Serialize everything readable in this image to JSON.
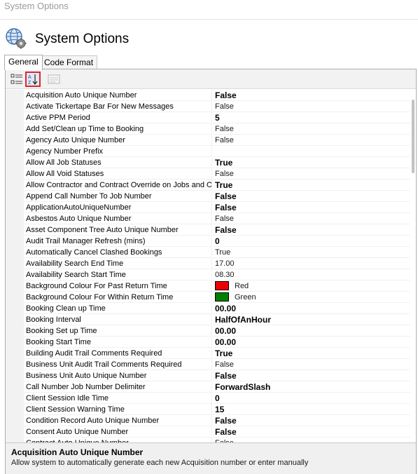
{
  "window": {
    "title": "System Options"
  },
  "header": {
    "title": "System Options",
    "icon": "globe-gear-icon"
  },
  "tabs": [
    {
      "label": "General",
      "active": true
    },
    {
      "label": "Code Format",
      "active": false
    }
  ],
  "toolbar": {
    "buttons": [
      {
        "icon": "categorized-view-icon"
      },
      {
        "icon": "alphabetical-sort-icon",
        "active": true
      },
      {
        "icon": "property-pages-icon",
        "disabled": true
      }
    ]
  },
  "properties": [
    {
      "name": "Acquisition Auto Unique Number",
      "value": "False",
      "bold": true
    },
    {
      "name": "Activate Tickertape Bar For New Messages",
      "value": "False",
      "bold": false
    },
    {
      "name": "Active PPM Period",
      "value": "5",
      "bold": true
    },
    {
      "name": "Add Set/Clean up Time to Booking",
      "value": "False",
      "bold": false
    },
    {
      "name": "Agency Auto Unique Number",
      "value": "False",
      "bold": false
    },
    {
      "name": "Agency Number Prefix",
      "value": "",
      "bold": false
    },
    {
      "name": "Allow All Job Statuses",
      "value": "True",
      "bold": true
    },
    {
      "name": "Allow All Void Statuses",
      "value": "False",
      "bold": false
    },
    {
      "name": "Allow Contractor and Contract Override on Jobs and Ord",
      "value": "True",
      "bold": true
    },
    {
      "name": "Append Call Number To Job Number",
      "value": "False",
      "bold": true
    },
    {
      "name": "ApplicationAutoUniqueNumber",
      "value": "False",
      "bold": true
    },
    {
      "name": "Asbestos Auto Unique Number",
      "value": "False",
      "bold": false
    },
    {
      "name": "Asset Component Tree Auto Unique Number",
      "value": "False",
      "bold": true
    },
    {
      "name": "Audit Trail Manager Refresh (mins)",
      "value": "0",
      "bold": true
    },
    {
      "name": "Automatically Cancel Clashed Bookings",
      "value": "True",
      "bold": false
    },
    {
      "name": "Availability Search End Time",
      "value": "17.00",
      "bold": false
    },
    {
      "name": "Availability Search Start Time",
      "value": "08.30",
      "bold": false
    },
    {
      "name": "Background Colour For Past Return Time",
      "value": "Red",
      "bold": false,
      "swatch": "#ee0000"
    },
    {
      "name": "Background Colour For Within Return Time",
      "value": "Green",
      "bold": false,
      "swatch": "#008000"
    },
    {
      "name": "Booking Clean up Time",
      "value": "00.00",
      "bold": true
    },
    {
      "name": "Booking Interval",
      "value": "HalfOfAnHour",
      "bold": true
    },
    {
      "name": "Booking Set up Time",
      "value": "00.00",
      "bold": true
    },
    {
      "name": "Booking Start Time",
      "value": "00.00",
      "bold": true
    },
    {
      "name": "Building Audit Trail Comments Required",
      "value": "True",
      "bold": true
    },
    {
      "name": "Business Unit Audit Trail Comments Required",
      "value": "False",
      "bold": false
    },
    {
      "name": "Business Unit Auto Unique Number",
      "value": "False",
      "bold": true
    },
    {
      "name": "Call Number Job Number Delimiter",
      "value": "ForwardSlash",
      "bold": true
    },
    {
      "name": "Client Session Idle Time",
      "value": "0",
      "bold": true
    },
    {
      "name": "Client Session Warning Time",
      "value": "15",
      "bold": true
    },
    {
      "name": "Condition Record Auto Unique Number",
      "value": "False",
      "bold": true
    },
    {
      "name": "Consent Auto Unique Number",
      "value": "False",
      "bold": true
    },
    {
      "name": "Contract Auto Unique Number",
      "value": "False",
      "bold": false
    }
  ],
  "description": {
    "title": "Acquisition Auto Unique Number",
    "text": "Allow system to automatically generate each new Acquisition number or enter manually"
  }
}
